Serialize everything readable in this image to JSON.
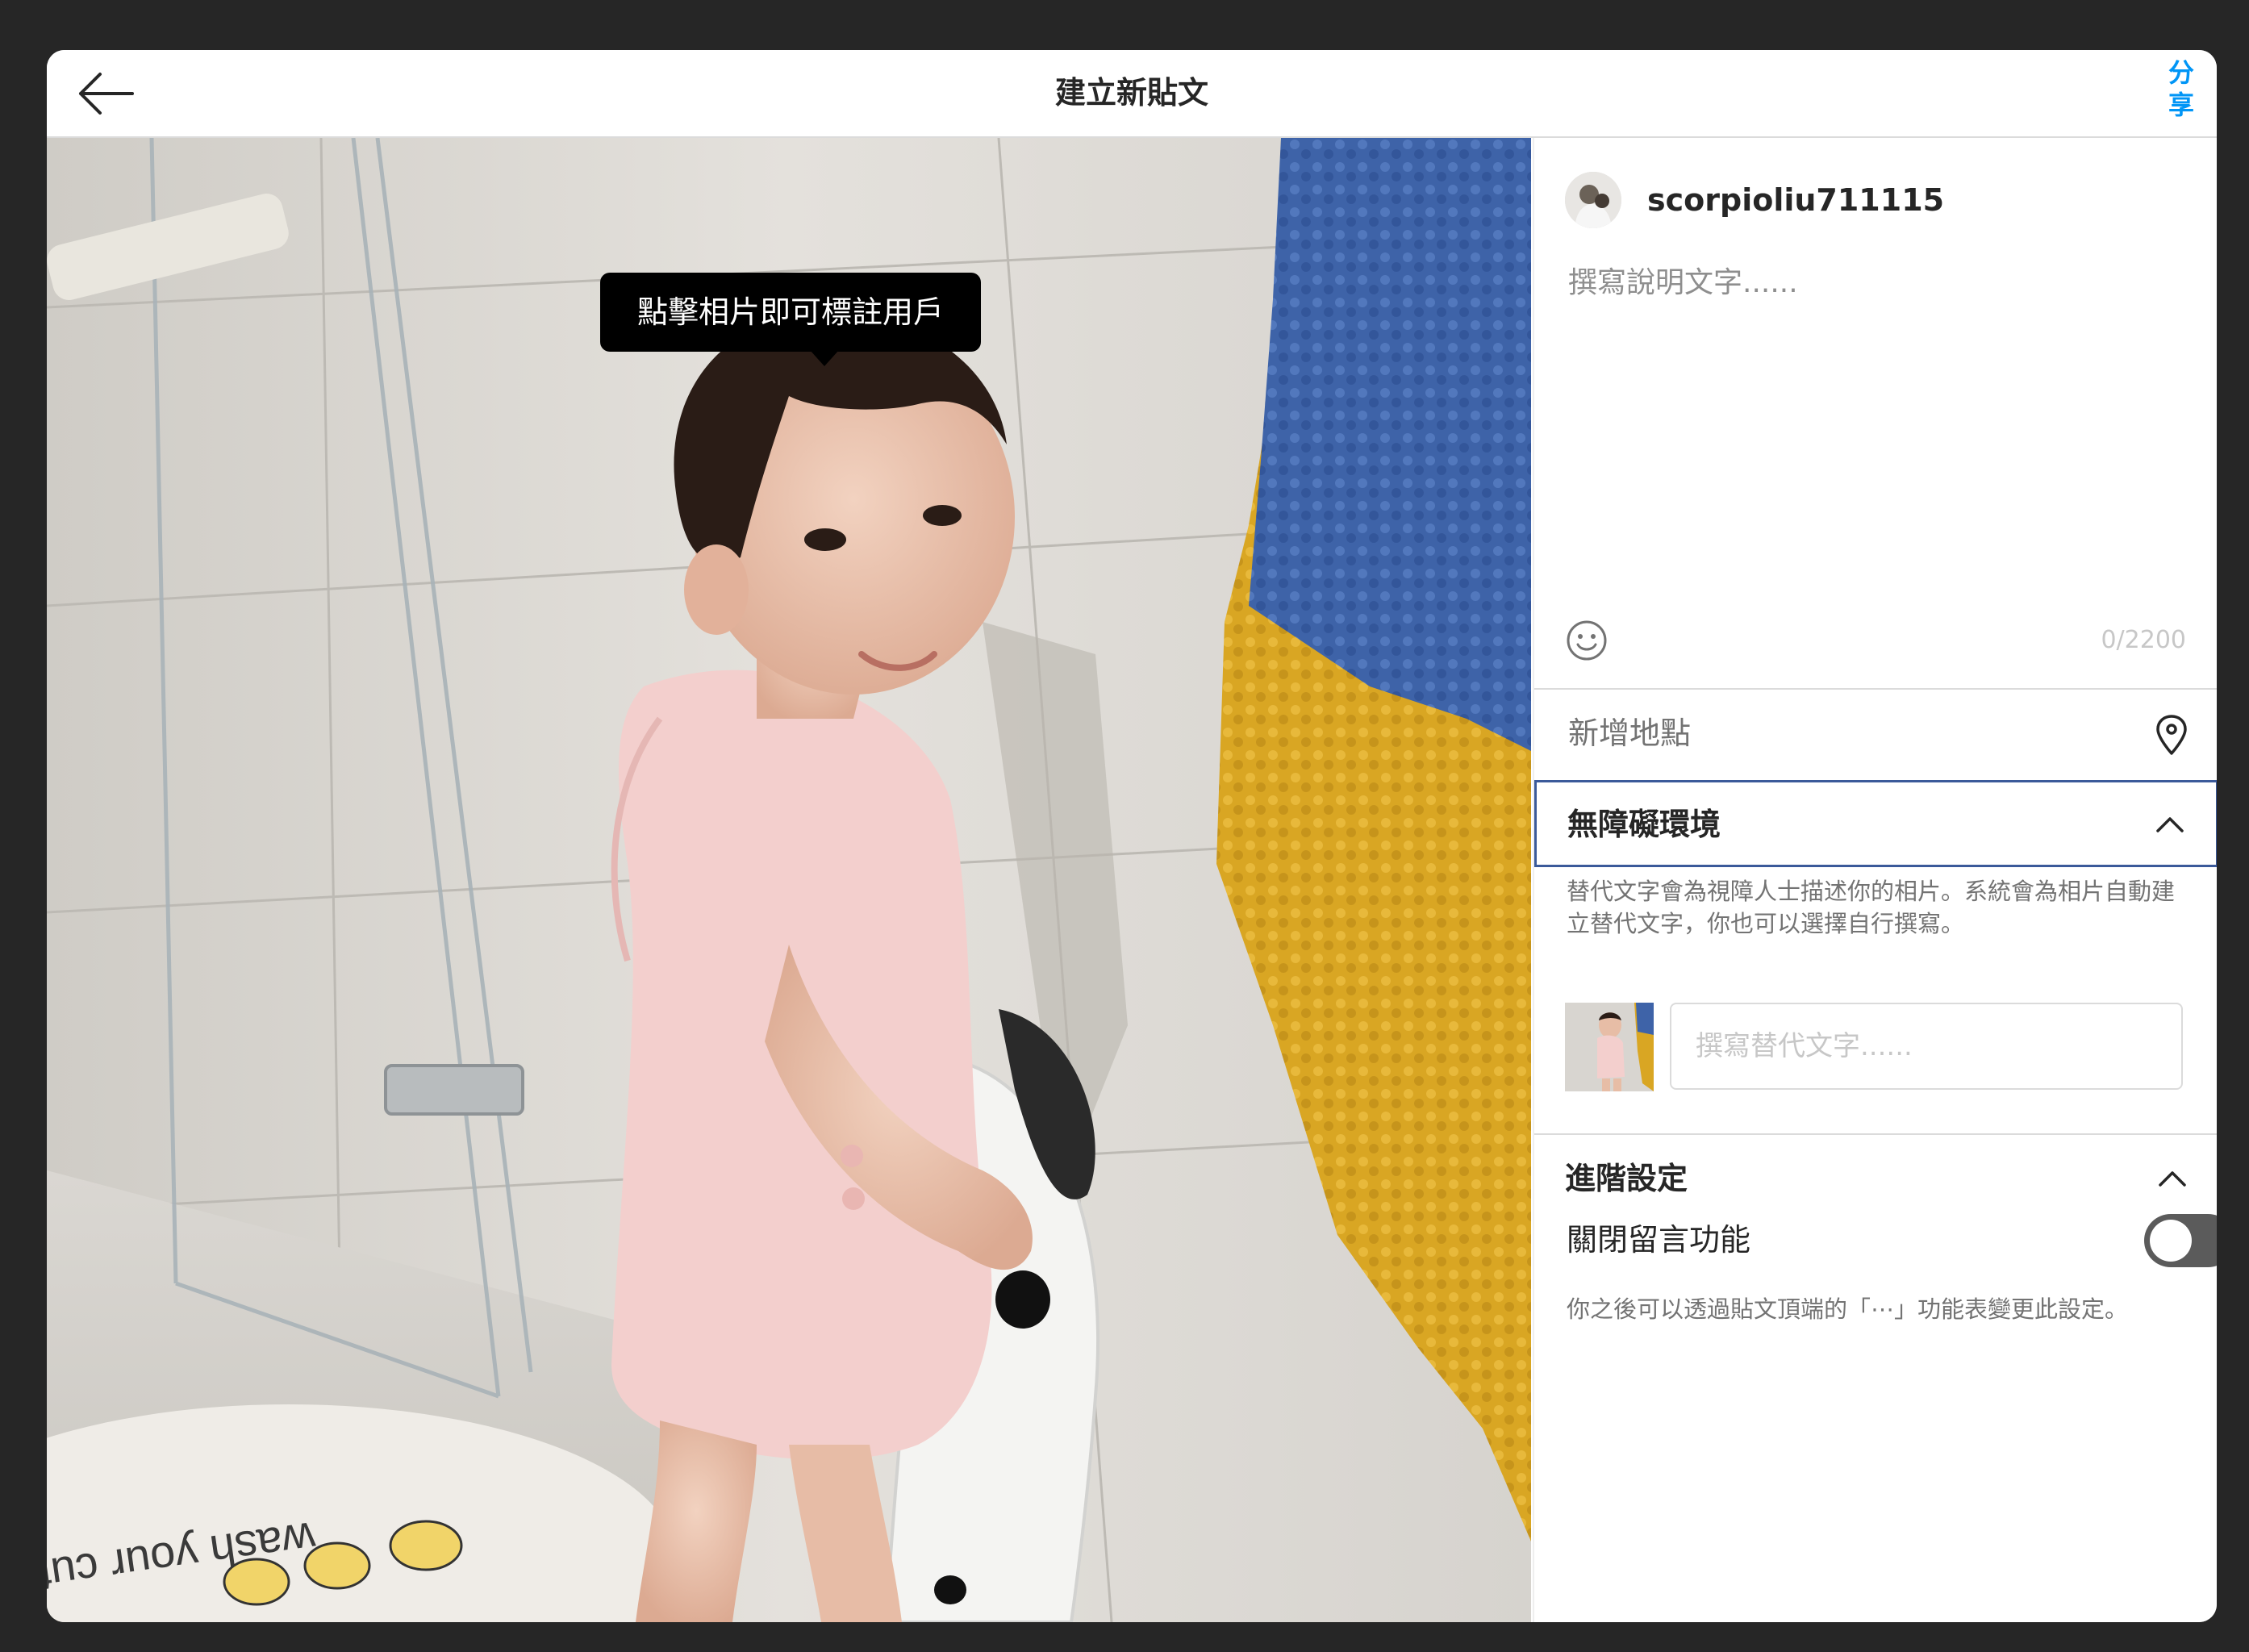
{
  "header": {
    "title": "建立新貼文",
    "share_label": "分享"
  },
  "photo": {
    "tag_tooltip": "點擊相片即可標註用戶",
    "mat_text": "wash your cute"
  },
  "sidebar": {
    "username": "scorpioliu711115",
    "caption_placeholder": "撰寫說明文字......",
    "char_count": "0/2200",
    "location_label": "新增地點",
    "accessibility": {
      "title": "無障礙環境",
      "description": "替代文字會為視障人士描述你的相片。系統會為相片自動建立替代文字，你也可以選擇自行撰寫。",
      "alt_placeholder": "撰寫替代文字......"
    },
    "advanced": {
      "title": "進階設定",
      "comments_label": "關閉留言功能",
      "comments_enabled_toggle": false,
      "description": "你之後可以透過貼文頂端的「⋯」功能表變更此設定。"
    }
  },
  "colors": {
    "share_blue": "#0095f6",
    "focus_border": "#3b5a9a",
    "toggle_off": "#5b5b5b"
  }
}
